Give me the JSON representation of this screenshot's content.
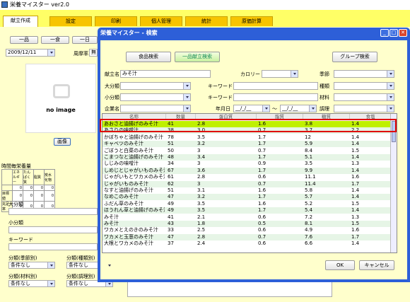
{
  "app": {
    "title": "栄養マイスター  ver2.0"
  },
  "tabs": [
    {
      "label": "献立作成",
      "active": true
    },
    {
      "label": "設定"
    },
    {
      "label": "印刷"
    },
    {
      "label": "個人管理"
    },
    {
      "label": "統計"
    },
    {
      "label": "原価計算"
    }
  ],
  "left": {
    "buttons": [
      "一品",
      "一食",
      "一日"
    ],
    "date": "2009/12/11",
    "shuuki_label": "周摩率",
    "shuuki_value": "無",
    "no_image": "no image",
    "image_button": "画像",
    "nutrition_title": "時間毎栄養量",
    "nutrition_headers": [
      "エネルギー",
      "たんぱく質",
      "脂質",
      "炭水化物"
    ],
    "nutrition_rows": [
      {
        "label": "",
        "values": [
          "0",
          "0",
          "0",
          "0"
        ]
      },
      {
        "label": "目標値",
        "values": [
          "0",
          "0",
          "0",
          "0"
        ]
      },
      {
        "label": "充足率",
        "values": [
          "0",
          "0",
          "0",
          "0"
        ]
      }
    ],
    "daibunrui": "大分類",
    "shoubunrui": "小分類",
    "keyword": "キーワード",
    "bunrui_kisetsu": "分類(季節別)",
    "bunrui_shurui": "分類(種類別)",
    "bunrui_zairyou": "分類(材料別)",
    "bunrui_chouri": "分類(調理別)",
    "jouken_nashi": "条件なし"
  },
  "dialog": {
    "title": "栄養マイスター - 検索",
    "btn_food": "食品検索",
    "btn_menu": "一品献立検索",
    "btn_group": "グループ検索",
    "menu_name_label": "献立名",
    "menu_name_value": "みそ汁",
    "calorie_label": "カロリー",
    "season_label": "季節",
    "daibunrui_label": "大分類",
    "keyword_label": "キーワード",
    "type_label": "種類",
    "shoubunrui_label": "小分類",
    "keyword2_label": "キーワード",
    "material_label": "材料",
    "company_label": "企業名",
    "date_label": "年月日",
    "date_from": "__/_/__",
    "date_to": "__/_/__",
    "tilde": "～",
    "cook_label": "調理",
    "ok": "OK",
    "cancel": "キャンセル"
  },
  "grid": {
    "headers": [
      "名称",
      "数量",
      "蛋白質",
      "脂質",
      "糖質",
      "食塩"
    ],
    "rows": [
      [
        "あおさと油揚げのみそ汁",
        "41",
        "2.8",
        "1.6",
        "3.8",
        "1.4"
      ],
      [
        "あさりの味噌汁",
        "38",
        "3.0",
        "0.7",
        "3.7",
        "2.2"
      ],
      [
        "かぼちゃと油揚げのみそ汁",
        "78",
        "3.5",
        "1.7",
        "12",
        "1.4"
      ],
      [
        "キャベツのみそ汁",
        "51",
        "3.2",
        "1.7",
        "5.9",
        "1.4"
      ],
      [
        "ごぼうと白菜のみそ汁",
        "50",
        "3",
        "0.7",
        "8.4",
        "1.5"
      ],
      [
        "こまつなと油揚げのみそ汁",
        "48",
        "3.4",
        "1.7",
        "5.1",
        "1.4"
      ],
      [
        "しじみの味噌汁",
        "34",
        "3",
        "0.9",
        "3.5",
        "1.3"
      ],
      [
        "しめじとじゃがいものみそ汁",
        "67",
        "3.6",
        "1.7",
        "9.9",
        "1.4"
      ],
      [
        "じゃがいもとワカメのみそ汁",
        "61",
        "2.8",
        "0.6",
        "11.1",
        "1.6"
      ],
      [
        "じゃがいものみそ汁",
        "62",
        "3",
        "0.7",
        "11.4",
        "1.7"
      ],
      [
        "なすと油揚げのみそ汁",
        "51",
        "3.1",
        "1.6",
        "5.8",
        "1.4"
      ],
      [
        "なめこのみそ汁",
        "47",
        "3.2",
        "1.7",
        "5.7",
        "1.4"
      ],
      [
        "ふだん草のみそ汁",
        "49",
        "3.5",
        "1.6",
        "5.2",
        "1.5"
      ],
      [
        "ほうれん草と油揚げのみそ汁",
        "49",
        "3.5",
        "1.7",
        "5.4",
        "1.4"
      ],
      [
        "みそ汁",
        "41",
        "2.1",
        "0.6",
        "7.2",
        "1.3"
      ],
      [
        "みそ汁",
        "43",
        "1.8",
        "0.5",
        "8.1",
        "1.5"
      ],
      [
        "ワカメとえのきのみそ汁",
        "33",
        "2.5",
        "0.6",
        "4.9",
        "1.6"
      ],
      [
        "ワカメと玉葱のみそ汁",
        "47",
        "2.8",
        "0.7",
        "7.6",
        "1.7"
      ],
      [
        "大根とワカメのみそ汁",
        "37",
        "2.4",
        "0.6",
        "6.6",
        "1.4"
      ]
    ]
  },
  "colors": {
    "highlight": "#bff000",
    "dialog_frame": "#2d5fd8",
    "panel": "#ffffcc",
    "tabbar": "#ffff66"
  }
}
